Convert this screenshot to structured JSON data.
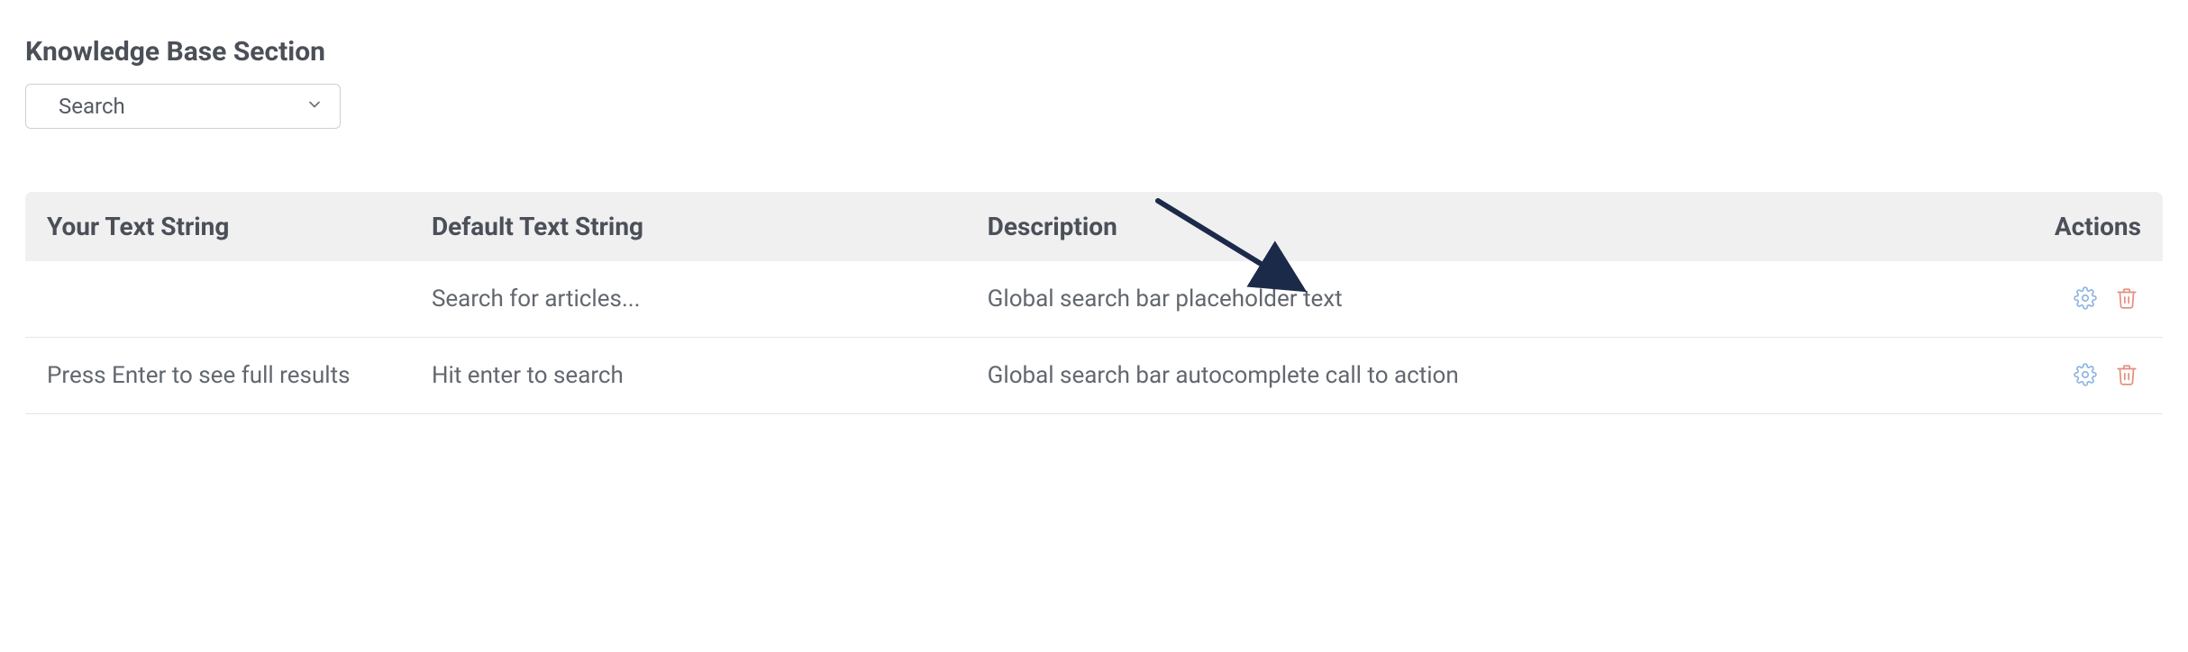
{
  "section": {
    "title": "Knowledge Base Section",
    "select_value": "Search"
  },
  "table": {
    "headers": {
      "your": "Your Text String",
      "default": "Default Text String",
      "description": "Description",
      "actions": "Actions"
    },
    "rows": [
      {
        "your": "",
        "default": "Search for articles...",
        "description": "Global search bar placeholder text"
      },
      {
        "your": "Press Enter to see full results",
        "default": "Hit enter to search",
        "description": "Global search bar autocomplete call to action"
      }
    ]
  }
}
